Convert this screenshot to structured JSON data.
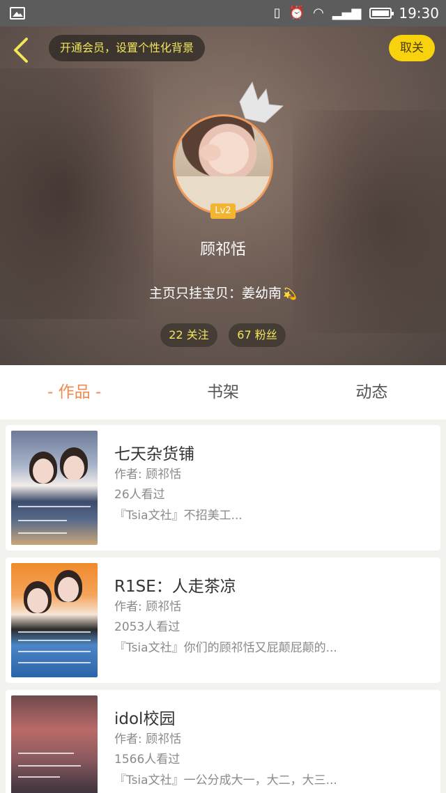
{
  "status_bar": {
    "time": "19:30",
    "icons": [
      "gallery-icon",
      "vibrate-off-icon",
      "alarm-icon",
      "wifi-icon",
      "signal-icon",
      "battery-icon"
    ]
  },
  "header": {
    "vip_banner": "开通会员，设置个性化背景",
    "unfollow_label": "取关",
    "level": "Lv2",
    "nickname": "顾祁恬",
    "bio": "主页只挂宝贝：姜幼南",
    "bio_emoji": "💫",
    "following": "22 关注",
    "fans": "67 粉丝",
    "accent_color": "#f7d20d"
  },
  "tabs": [
    {
      "label": "- 作品 -",
      "active": true
    },
    {
      "label": "书架",
      "active": false
    },
    {
      "label": "动态",
      "active": false
    }
  ],
  "works": [
    {
      "title": "七天杂货铺",
      "author": "作者: 顾祁恬",
      "views": "26人看过",
      "desc": "『Tsia文社』不招美工..."
    },
    {
      "title": "R1SE：人走茶凉",
      "author": "作者: 顾祁恬",
      "views": "2053人看过",
      "desc": "『Tsia文社』你们的顾祁恬又屁颠屁颠的..."
    },
    {
      "title": "idol校园",
      "author": "作者: 顾祁恬",
      "views": "1566人看过",
      "desc": "『Tsia文社』一公分成大一，大二，大三..."
    }
  ]
}
